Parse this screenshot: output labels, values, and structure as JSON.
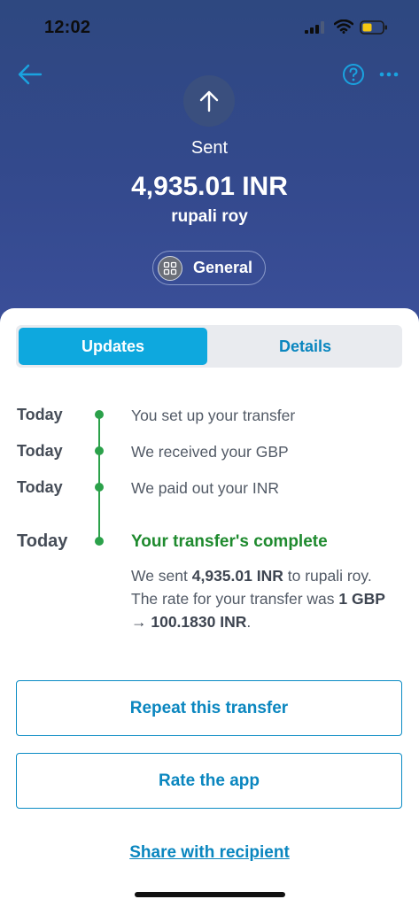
{
  "status_bar": {
    "time": "12:02"
  },
  "header": {
    "status": "Sent",
    "amount": "4,935.01 INR",
    "recipient": "rupali roy",
    "category": "General"
  },
  "tabs": [
    {
      "label": "Updates",
      "active": true
    },
    {
      "label": "Details",
      "active": false
    }
  ],
  "timeline": [
    {
      "day": "Today",
      "text": "You set up your transfer"
    },
    {
      "day": "Today",
      "text": "We received your GBP"
    },
    {
      "day": "Today",
      "text": "We paid out your INR"
    }
  ],
  "final_step": {
    "day": "Today",
    "title": "Your transfer's complete",
    "body": {
      "p1": "We sent ",
      "amount": "4,935.01 INR",
      "p2": " to rupali roy. The rate for your transfer was ",
      "rate": "1 GBP → 100.1830 INR",
      "p3": "."
    }
  },
  "actions": {
    "repeat": "Repeat this transfer",
    "rate_app": "Rate the app",
    "share": "Share with recipient"
  },
  "colors": {
    "header_bg": "#33498c",
    "accent": "#0ea8de",
    "link": "#0a86bf",
    "success": "#2ba14a"
  },
  "icons": [
    "signal-icon",
    "wifi-icon",
    "battery-icon",
    "back-arrow-icon",
    "help-icon",
    "more-icon",
    "arrow-up-icon",
    "category-grid-icon"
  ]
}
